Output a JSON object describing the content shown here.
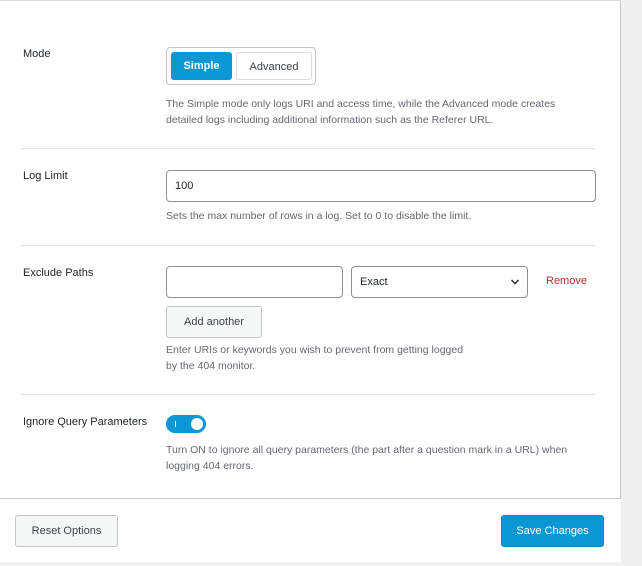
{
  "mode": {
    "label": "Mode",
    "options": [
      "Simple",
      "Advanced"
    ],
    "selected": "Simple",
    "description_line1": "The Simple mode only logs URI and access time, while the Advanced mode creates",
    "description_line2": "detailed logs including additional information such as the Referer URL."
  },
  "log_limit": {
    "label": "Log Limit",
    "value": "100",
    "description": "Sets the max number of rows in a log. Set to 0 to disable the limit."
  },
  "exclude_paths": {
    "label": "Exclude Paths",
    "path_value": "",
    "match_type": "Exact",
    "remove_label": "Remove",
    "add_label": "Add another",
    "description_line1": "Enter URIs or keywords you wish to prevent from getting logged",
    "description_line2": "by the 404 monitor."
  },
  "ignore_query": {
    "label": "Ignore Query Parameters",
    "enabled": true,
    "description_line1": "Turn ON to ignore all query parameters (the part after a question mark in a URL) when",
    "description_line2": "logging 404 errors."
  },
  "footer": {
    "reset_label": "Reset Options",
    "save_label": "Save Changes"
  },
  "colors": {
    "accent": "#0a97d4",
    "danger": "#b32d2e",
    "muted_text": "#646970"
  },
  "icons": {
    "select_chevron": "chevron-down-icon"
  }
}
